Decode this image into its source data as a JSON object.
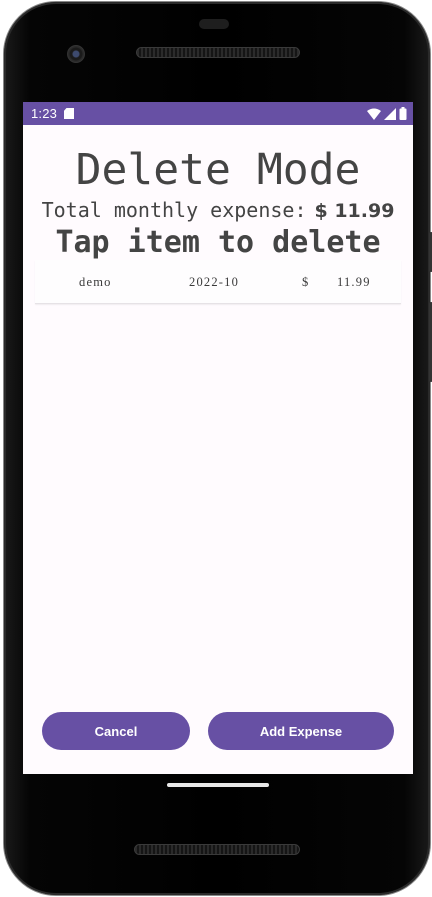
{
  "status_bar": {
    "time": "1:23",
    "background": "#6750a4",
    "icons": [
      "sd-card-icon",
      "wifi-icon",
      "signal-icon",
      "battery-icon"
    ]
  },
  "header": {
    "title": "Delete Mode",
    "total_label": "Total monthly expense:",
    "total_amount": "$ 11.99",
    "instruction": "Tap item to delete"
  },
  "expenses": [
    {
      "name": "demo",
      "date": "2022-10",
      "currency": "$",
      "amount": "11.99"
    }
  ],
  "buttons": {
    "cancel": "Cancel",
    "add_expense": "Add Expense"
  },
  "colors": {
    "accent": "#6750a4",
    "screen_bg": "#fffbfe",
    "text": "#444444"
  }
}
